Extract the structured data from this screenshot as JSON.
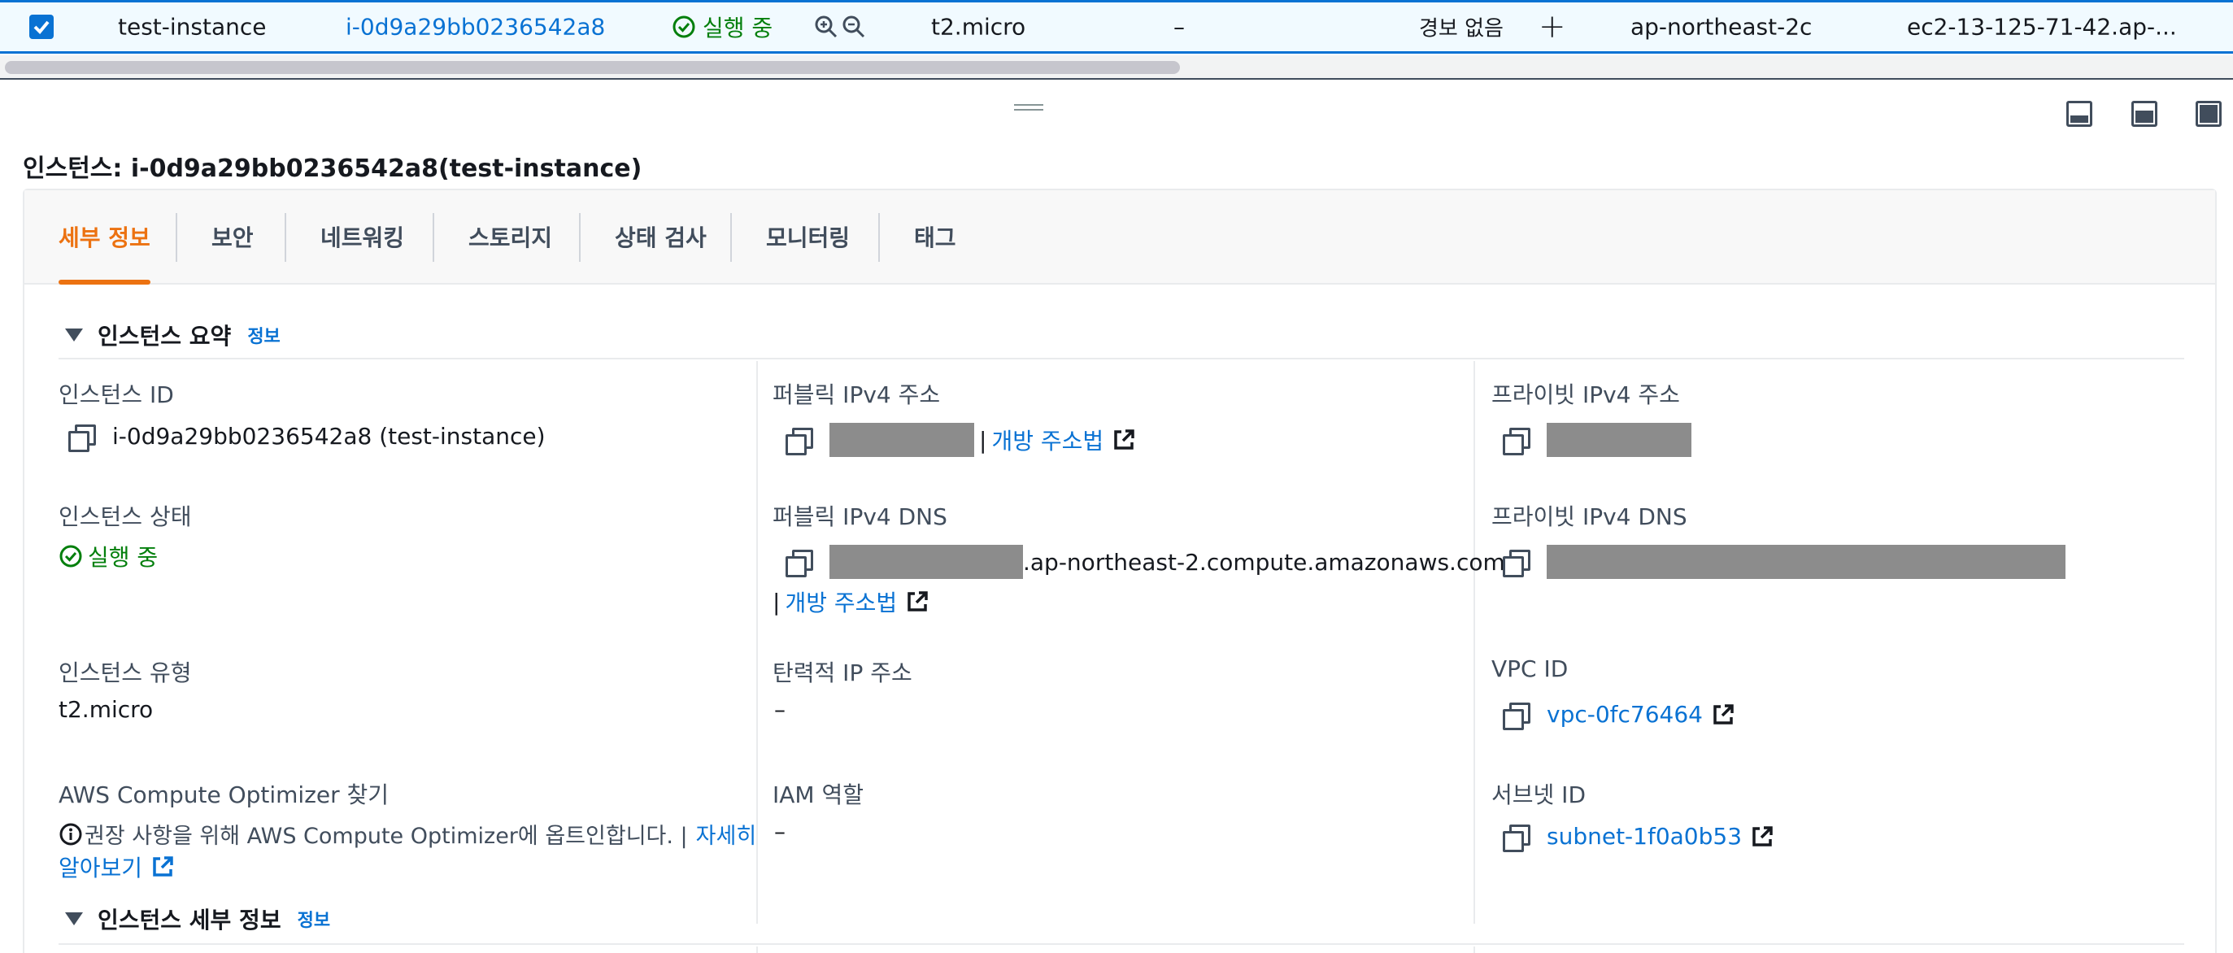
{
  "instance_row": {
    "name": "test-instance",
    "instance_id": "i-0d9a29bb0236542a8",
    "status": "실행 중",
    "instance_type": "t2.micro",
    "status_check": "–",
    "alarm_status": "경보 없음",
    "add_alarm": "+",
    "availability_zone": "ap-northeast-2c",
    "public_dns": "ec2-13-125-71-42.ap-..."
  },
  "detail": {
    "title": "인스턴스: i-0d9a29bb0236542a8(test-instance)"
  },
  "tabs": [
    {
      "label": "세부 정보",
      "active": true
    },
    {
      "label": "보안",
      "active": false
    },
    {
      "label": "네트워킹",
      "active": false
    },
    {
      "label": "스토리지",
      "active": false
    },
    {
      "label": "상태 검사",
      "active": false
    },
    {
      "label": "모니터링",
      "active": false
    },
    {
      "label": "태그",
      "active": false
    }
  ],
  "summary": {
    "heading": "인스턴스 요약",
    "info_link": "정보",
    "instance_id_label": "인스턴스 ID",
    "instance_id_value": "i-0d9a29bb0236542a8 (test-instance)",
    "public_ipv4_label": "퍼블릭 IPv4 주소",
    "public_ipv4_sep": "|",
    "public_ipv4_link": "개방 주소법",
    "private_ipv4_label": "프라이빗 IPv4 주소",
    "state_label": "인스턴스 상태",
    "state_value": "실행 중",
    "public_dns_label": "퍼블릭 IPv4 DNS",
    "public_dns_suffix": ".ap-northeast-2.compute.amazonaws.com",
    "public_dns_sep": "|",
    "public_dns_link": "개방 주소법",
    "private_dns_label": "프라이빗 IPv4 DNS",
    "type_label": "인스턴스 유형",
    "type_value": "t2.micro",
    "elastic_ip_label": "탄력적 IP 주소",
    "elastic_ip_value": "–",
    "vpc_label": "VPC ID",
    "vpc_value": "vpc-0fc76464",
    "optimizer_label": "AWS Compute Optimizer 찾기",
    "optimizer_text": "권장 사항을 위해 AWS Compute Optimizer에 옵트인합니다. |",
    "optimizer_link_1": "자세히",
    "optimizer_link_2": "알아보기",
    "iam_label": "IAM 역할",
    "iam_value": "–",
    "subnet_label": "서브넷 ID",
    "subnet_value": "subnet-1f0a0b53"
  },
  "details_section": {
    "heading": "인스턴스 세부 정보",
    "info_link": "정보"
  },
  "colors": {
    "link": "#0972d3",
    "active_tab": "#ec7211",
    "success": "#037f0c",
    "redaction": "#8c8c8c"
  },
  "icons": [
    "checkbox-checked-icon",
    "status-check-icon",
    "zoom-in-icon",
    "zoom-out-icon",
    "plus-icon",
    "copy-icon",
    "external-link-icon",
    "info-circle-icon",
    "caret-down-icon"
  ]
}
